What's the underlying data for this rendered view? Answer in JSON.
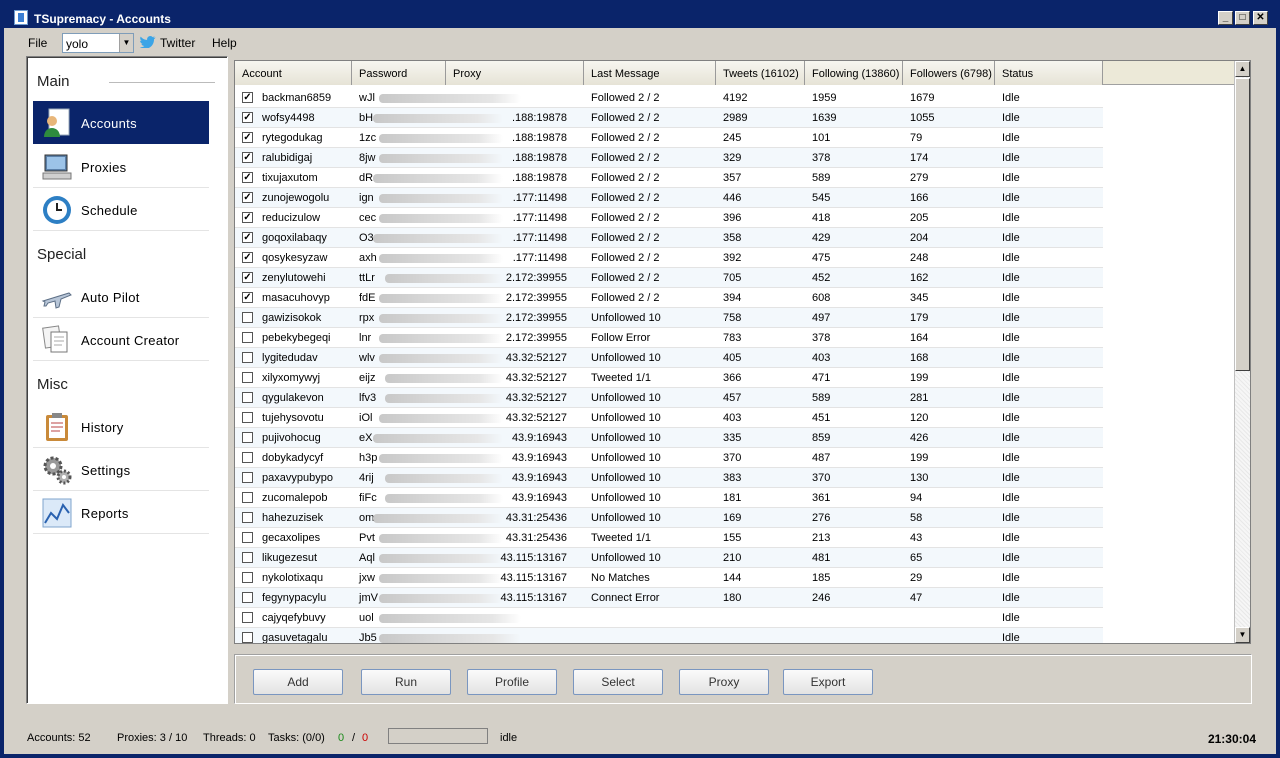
{
  "window": {
    "title": "TSupremacy - Accounts",
    "controls": [
      "_",
      "□",
      "✕"
    ]
  },
  "menu": {
    "file": "File",
    "profile_value": "yolo",
    "twitter": "Twitter",
    "help": "Help"
  },
  "sidebar": {
    "sections": [
      {
        "title": "Main",
        "items": [
          {
            "label": "Accounts",
            "icon": "user-document-icon",
            "active": true
          },
          {
            "label": "Proxies",
            "icon": "computer-icon"
          },
          {
            "label": "Schedule",
            "icon": "clock-icon"
          }
        ]
      },
      {
        "title": "Special",
        "items": [
          {
            "label": "Auto Pilot",
            "icon": "airplane-icon"
          },
          {
            "label": "Account Creator",
            "icon": "documents-icon"
          }
        ]
      },
      {
        "title": "Misc",
        "items": [
          {
            "label": "History",
            "icon": "clipboard-icon"
          },
          {
            "label": "Settings",
            "icon": "gears-icon"
          },
          {
            "label": "Reports",
            "icon": "chart-icon"
          }
        ]
      }
    ]
  },
  "grid": {
    "columns": [
      "Account",
      "Password",
      "Proxy",
      "Last Message",
      "Tweets (16102)",
      "Following (13860)",
      "Followers (6798)",
      "Status"
    ],
    "rows": [
      {
        "checked": true,
        "account": "backman6859",
        "pw": "wJl",
        "proxy": "",
        "msg": "Followed 2 / 2",
        "tweets": "4192",
        "following": "1959",
        "followers": "1679",
        "status": "Idle"
      },
      {
        "checked": true,
        "account": "wofsy4498",
        "pw": "bH",
        "proxy": ".188:19878",
        "msg": "Followed 2 / 2",
        "tweets": "2989",
        "following": "1639",
        "followers": "1055",
        "status": "Idle"
      },
      {
        "checked": true,
        "account": "rytegodukag",
        "pw": "1zc",
        "proxy": ".188:19878",
        "msg": "Followed 2 / 2",
        "tweets": "245",
        "following": "101",
        "followers": "79",
        "status": "Idle"
      },
      {
        "checked": true,
        "account": "ralubidigaj",
        "pw": "8jw",
        "proxy": ".188:19878",
        "msg": "Followed 2 / 2",
        "tweets": "329",
        "following": "378",
        "followers": "174",
        "status": "Idle"
      },
      {
        "checked": true,
        "account": "tixujaxutom",
        "pw": "dR",
        "proxy": ".188:19878",
        "msg": "Followed 2 / 2",
        "tweets": "357",
        "following": "589",
        "followers": "279",
        "status": "Idle"
      },
      {
        "checked": true,
        "account": "zunojewogolu",
        "pw": "ign",
        "proxy": ".177:11498",
        "msg": "Followed 2 / 2",
        "tweets": "446",
        "following": "545",
        "followers": "166",
        "status": "Idle"
      },
      {
        "checked": true,
        "account": "reducizulow",
        "pw": "cec",
        "proxy": ".177:11498",
        "msg": "Followed 2 / 2",
        "tweets": "396",
        "following": "418",
        "followers": "205",
        "status": "Idle"
      },
      {
        "checked": true,
        "account": "goqoxilabaqy",
        "pw": "O3",
        "proxy": ".177:11498",
        "msg": "Followed 2 / 2",
        "tweets": "358",
        "following": "429",
        "followers": "204",
        "status": "Idle"
      },
      {
        "checked": true,
        "account": "qosykesyzaw",
        "pw": "axh",
        "proxy": ".177:11498",
        "msg": "Followed 2 / 2",
        "tweets": "392",
        "following": "475",
        "followers": "248",
        "status": "Idle"
      },
      {
        "checked": true,
        "account": "zenylutowehi",
        "pw": "ttLr",
        "proxy": "2.172:39955",
        "msg": "Followed 2 / 2",
        "tweets": "705",
        "following": "452",
        "followers": "162",
        "status": "Idle"
      },
      {
        "checked": true,
        "account": "masacuhovyp",
        "pw": "fdE",
        "proxy": "2.172:39955",
        "msg": "Followed 2 / 2",
        "tweets": "394",
        "following": "608",
        "followers": "345",
        "status": "Idle"
      },
      {
        "checked": false,
        "account": "gawizisokok",
        "pw": "rpx",
        "proxy": "2.172:39955",
        "msg": "Unfollowed 10",
        "tweets": "758",
        "following": "497",
        "followers": "179",
        "status": "Idle"
      },
      {
        "checked": false,
        "account": "pebekybegeqi",
        "pw": "lnr",
        "proxy": "2.172:39955",
        "msg": "Follow Error",
        "tweets": "783",
        "following": "378",
        "followers": "164",
        "status": "Idle"
      },
      {
        "checked": false,
        "account": "lygitedudav",
        "pw": "wlv",
        "proxy": "43.32:52127",
        "msg": "Unfollowed 10",
        "tweets": "405",
        "following": "403",
        "followers": "168",
        "status": "Idle"
      },
      {
        "checked": false,
        "account": "xilyxomywyj",
        "pw": "eijz",
        "proxy": "43.32:52127",
        "msg": "Tweeted 1/1",
        "tweets": "366",
        "following": "471",
        "followers": "199",
        "status": "Idle"
      },
      {
        "checked": false,
        "account": "qygulakevon",
        "pw": "lfv3",
        "proxy": "43.32:52127",
        "msg": "Unfollowed 10",
        "tweets": "457",
        "following": "589",
        "followers": "281",
        "status": "Idle"
      },
      {
        "checked": false,
        "account": "tujehysovotu",
        "pw": "iOl",
        "proxy": "43.32:52127",
        "msg": "Unfollowed 10",
        "tweets": "403",
        "following": "451",
        "followers": "120",
        "status": "Idle"
      },
      {
        "checked": false,
        "account": "pujivohocug",
        "pw": "eX",
        "proxy": "43.9:16943",
        "msg": "Unfollowed 10",
        "tweets": "335",
        "following": "859",
        "followers": "426",
        "status": "Idle"
      },
      {
        "checked": false,
        "account": "dobykadycyf",
        "pw": "h3p",
        "proxy": "43.9:16943",
        "msg": "Unfollowed 10",
        "tweets": "370",
        "following": "487",
        "followers": "199",
        "status": "Idle"
      },
      {
        "checked": false,
        "account": "paxavypubypo",
        "pw": "4rij",
        "proxy": "43.9:16943",
        "msg": "Unfollowed 10",
        "tweets": "383",
        "following": "370",
        "followers": "130",
        "status": "Idle"
      },
      {
        "checked": false,
        "account": "zucomalepob",
        "pw": "fiFc",
        "proxy": "43.9:16943",
        "msg": "Unfollowed 10",
        "tweets": "181",
        "following": "361",
        "followers": "94",
        "status": "Idle"
      },
      {
        "checked": false,
        "account": "hahezuzisek",
        "pw": "om",
        "proxy": "43.31:25436",
        "msg": "Unfollowed 10",
        "tweets": "169",
        "following": "276",
        "followers": "58",
        "status": "Idle"
      },
      {
        "checked": false,
        "account": "gecaxolipes",
        "pw": "Pvt",
        "proxy": "43.31:25436",
        "msg": "Tweeted 1/1",
        "tweets": "155",
        "following": "213",
        "followers": "43",
        "status": "Idle"
      },
      {
        "checked": false,
        "account": "likugezesut",
        "pw": "Aql",
        "proxy": "43.115:13167",
        "msg": "Unfollowed 10",
        "tweets": "210",
        "following": "481",
        "followers": "65",
        "status": "Idle"
      },
      {
        "checked": false,
        "account": "nykolotixaqu",
        "pw": "jxw",
        "proxy": "43.115:13167",
        "msg": "No Matches",
        "tweets": "144",
        "following": "185",
        "followers": "29",
        "status": "Idle"
      },
      {
        "checked": false,
        "account": "fegynypacylu",
        "pw": "jmV",
        "proxy": "43.115:13167",
        "msg": "Connect Error",
        "tweets": "180",
        "following": "246",
        "followers": "47",
        "status": "Idle"
      },
      {
        "checked": false,
        "account": "cajyqefybuvy",
        "pw": "uol",
        "proxy": "",
        "msg": "",
        "tweets": "",
        "following": "",
        "followers": "",
        "status": "Idle"
      },
      {
        "checked": false,
        "account": "gasuvetagalu",
        "pw": "Jb5",
        "proxy": "",
        "msg": "",
        "tweets": "",
        "following": "",
        "followers": "",
        "status": "Idle"
      }
    ]
  },
  "buttons": [
    "Add",
    "Run",
    "Profile",
    "Select",
    "Proxy",
    "Export"
  ],
  "status": {
    "accounts": "Accounts: 52",
    "proxies": "Proxies: 3 / 10",
    "threads": "Threads: 0",
    "tasks": "Tasks: (0/0)",
    "ok_count": "0",
    "sep": "/",
    "err_count": "0",
    "state": "idle",
    "clock": "21:30:04"
  },
  "colors": {
    "titlebar": "#0a246a",
    "active_nav": "#0a246a",
    "ok": "#1a8a1a",
    "err": "#cc0000"
  }
}
